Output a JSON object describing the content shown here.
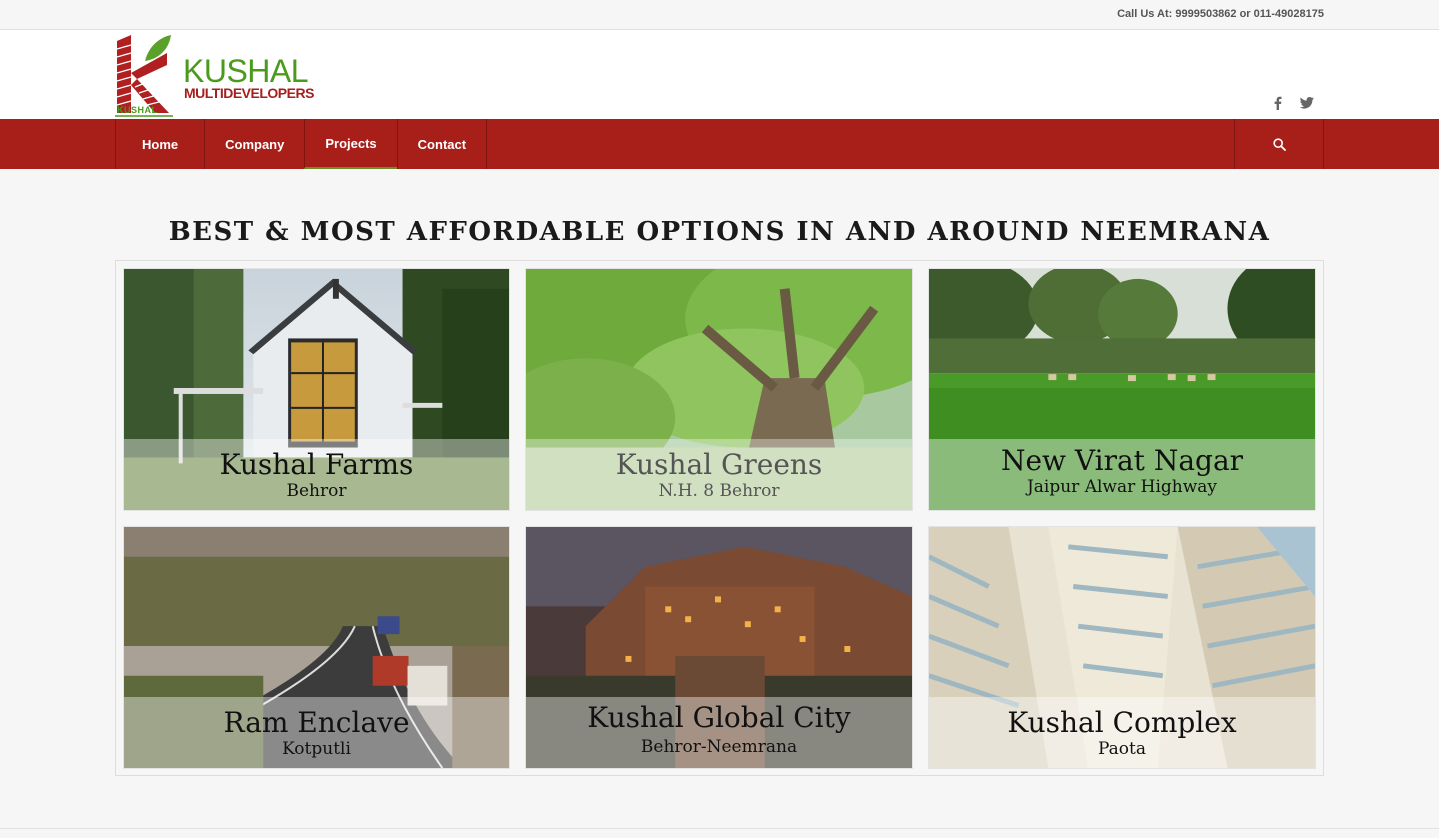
{
  "topbar": {
    "call_text": "Call Us At: 9999503862 or 011-49028175"
  },
  "brand": {
    "name": "KUSHAL",
    "tagline": "MULTIDEVELOPERS",
    "mark_label": "KUSHAL",
    "colors": {
      "green": "#4a9a1c",
      "red": "#a61e1e"
    }
  },
  "social": {
    "facebook_icon": "facebook-icon",
    "twitter_icon": "twitter-icon"
  },
  "nav": {
    "items": [
      {
        "label": "Home"
      },
      {
        "label": "Company"
      },
      {
        "label": "Projects"
      },
      {
        "label": "Contact"
      }
    ],
    "active": "Projects",
    "search_icon": "search-icon",
    "bar_color": "#a81f1a"
  },
  "main": {
    "heading": "BEST & MOST AFFORDABLE OPTIONS IN AND AROUND NEEMRANA"
  },
  "projects": [
    {
      "title": "Kushal Farms",
      "location": "Behror"
    },
    {
      "title": "Kushal Greens",
      "location": "N.H. 8 Behror"
    },
    {
      "title": "New Virat Nagar",
      "location": "Jaipur Alwar Highway"
    },
    {
      "title": "Ram Enclave",
      "location": "Kotputli"
    },
    {
      "title": "Kushal Global City",
      "location": "Behror-Neemrana"
    },
    {
      "title": "Kushal Complex",
      "location": "Paota"
    }
  ]
}
